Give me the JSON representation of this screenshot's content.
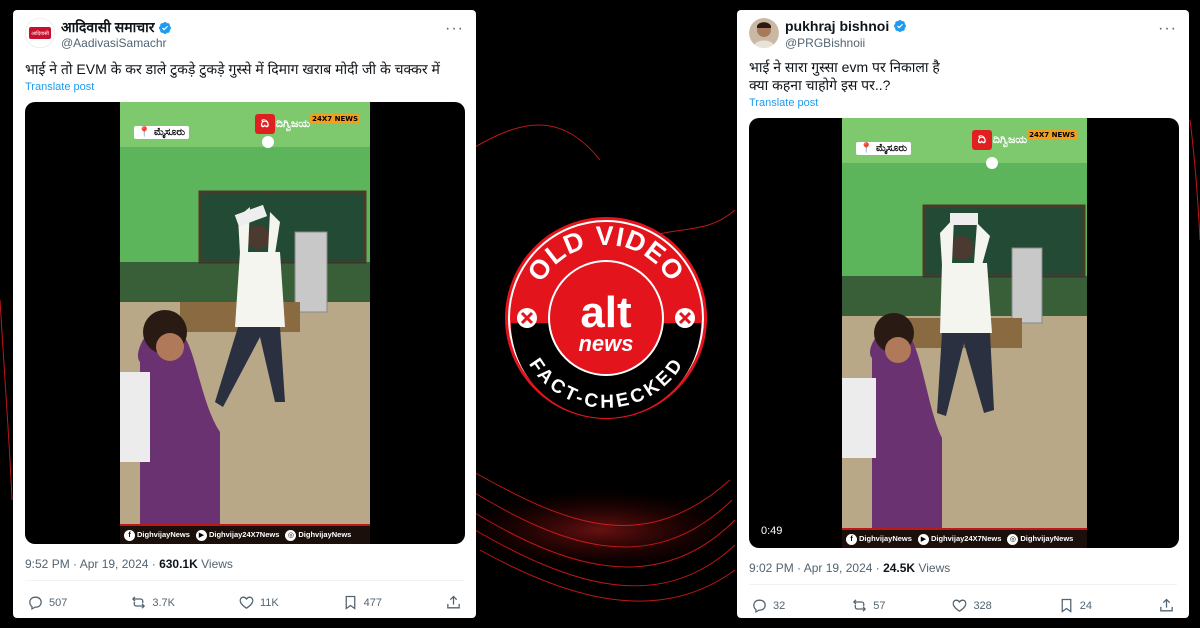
{
  "left_post": {
    "name": "आदिवासी समाचार",
    "handle": "@AadivasiSamachr",
    "text": "भाई ने तो EVM के कर डाले टुकड़े टुकड़े गुस्से में दिमाग खराब मोदी जी के चक्कर में",
    "translate": "Translate post",
    "video": {
      "location_tag": "ಮೈಸೂರು",
      "channel": "ದಿಗ್ವಿಜಯ",
      "channel_badge": "24X7 NEWS",
      "socials": [
        "DighvijayNews",
        "Dighvijay24X7News",
        "DighvijayNews"
      ]
    },
    "time": "9:52 PM · Apr 19, 2024 · ",
    "views_count": "630.1K",
    "views_label": " Views",
    "replies": "507",
    "reposts": "3.7K",
    "likes": "11K",
    "bookmarks": "477"
  },
  "right_post": {
    "name": "pukhraj bishnoi",
    "handle": "@PRGBishnoii",
    "text": "भाई ने सारा गुस्सा evm पर निकाला है\nक्या कहना चाहोगे इस पर..?",
    "translate": "Translate post",
    "video": {
      "location_tag": "ಮೈಸೂರು",
      "channel": "ದಿಗ್ವಿಜಯ",
      "channel_badge": "24X7 NEWS",
      "duration": "0:49",
      "socials": [
        "DighvijayNews",
        "Dighvijay24X7News",
        "DighvijayNews"
      ]
    },
    "time": "9:02 PM · Apr 19, 2024 · ",
    "views_count": "24.5K",
    "views_label": " Views",
    "replies": "32",
    "reposts": "57",
    "likes": "328",
    "bookmarks": "24"
  },
  "badge": {
    "top_text": "OLD VIDEO",
    "bottom_text": "FACT-CHECKED",
    "logo_top": "alt",
    "logo_bottom": "news"
  },
  "colors": {
    "badge_red": "#e3141c",
    "link_blue": "#1d9bf0",
    "verified_blue": "#1d9bf0"
  }
}
